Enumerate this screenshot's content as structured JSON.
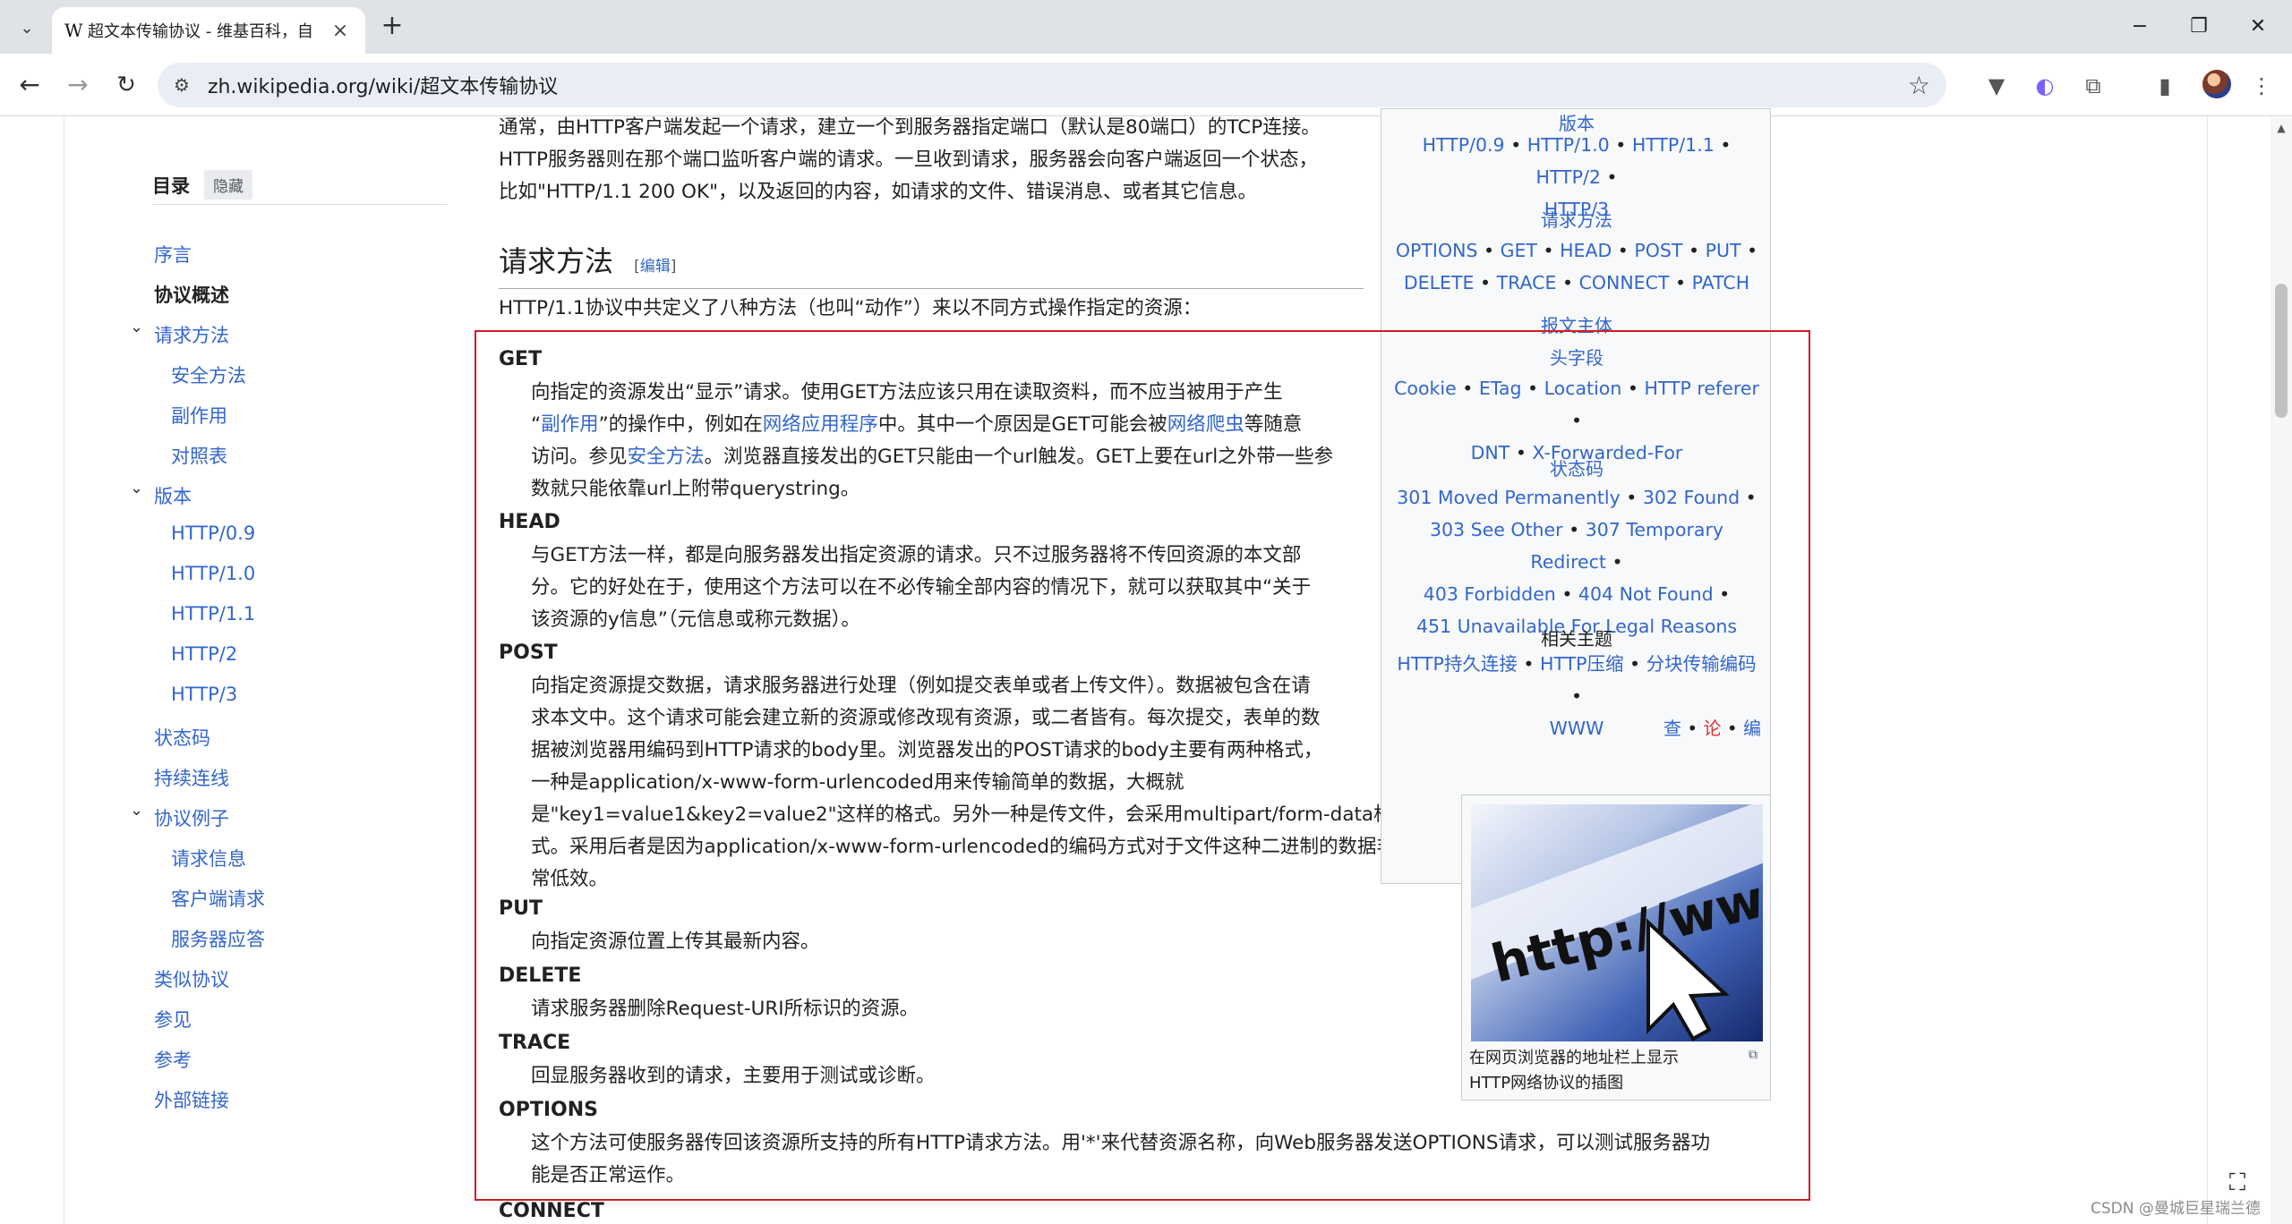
{
  "browser": {
    "tab_title": "超文本传输协议 - 维基百科，自",
    "url": "zh.wikipedia.org/wiki/超文本传输协议",
    "favicon": "W"
  },
  "toc": {
    "title": "目录",
    "hide": "隐藏",
    "items": [
      {
        "label": "序言"
      },
      {
        "label": "协议概述"
      },
      {
        "label": "请求方法"
      },
      {
        "label": "安全方法"
      },
      {
        "label": "副作用"
      },
      {
        "label": "对照表"
      },
      {
        "label": "版本"
      },
      {
        "label": "HTTP/0.9"
      },
      {
        "label": "HTTP/1.0"
      },
      {
        "label": "HTTP/1.1"
      },
      {
        "label": "HTTP/2"
      },
      {
        "label": "HTTP/3"
      },
      {
        "label": "状态码"
      },
      {
        "label": "持续连线"
      },
      {
        "label": "协议例子"
      },
      {
        "label": "请求信息"
      },
      {
        "label": "客户端请求"
      },
      {
        "label": "服务器应答"
      },
      {
        "label": "类似协议"
      },
      {
        "label": "参见"
      },
      {
        "label": "参考"
      },
      {
        "label": "外部链接"
      }
    ]
  },
  "content": {
    "intro_lines": [
      "通常，由HTTP客户端发起一个请求，建立一个到服务器指定端口（默认是80端口）的TCP连接。",
      "HTTP服务器则在那个端口监听客户端的请求。一旦收到请求，服务器会向客户端返回一个状态，",
      "比如\"HTTP/1.1 200 OK\"，以及返回的内容，如请求的文件、错误消息、或者其它信息。"
    ],
    "section_title": "请求方法",
    "edit_open": "[",
    "edit_label": "编辑",
    "edit_close": "]",
    "section_lead": "HTTP/1.1协议中共定义了八种方法（也叫“动作”）来以不同方式操作指定的资源：",
    "methods": [
      {
        "name": "GET",
        "lines": [
          "向指定的资源发出“显示”请求。使用GET方法应该只用在读取资料，而不应当被用于产生",
          [
            "“",
            {
              "link": "副作用"
            },
            "”的操作中，例如在",
            {
              "link": "网络应用程序"
            },
            "中。其中一个原因是GET可能会被",
            {
              "link": "网络爬虫"
            },
            "等随意"
          ],
          [
            "访问。参见",
            {
              "link": "安全方法"
            },
            "。浏览器直接发出的GET只能由一个url触发。GET上要在url之外带一些参"
          ],
          "数就只能依靠url上附带querystring。"
        ]
      },
      {
        "name": "HEAD",
        "lines": [
          "与GET方法一样，都是向服务器发出指定资源的请求。只不过服务器将不传回资源的本文部",
          "分。它的好处在于，使用这个方法可以在不必传输全部内容的情况下，就可以获取其中“关于",
          "该资源的y信息”（元信息或称元数据）。"
        ]
      },
      {
        "name": "POST",
        "lines": [
          "向指定资源提交数据，请求服务器进行处理（例如提交表单或者上传文件）。数据被包含在请",
          "求本文中。这个请求可能会建立新的资源或修改现有资源，或二者皆有。每次提交，表单的数",
          "据被浏览器用编码到HTTP请求的body里。浏览器发出的POST请求的body主要有两种格式，",
          "一种是application/x-www-form-urlencoded用来传输简单的数据，大概就",
          "是\"key1=value1&key2=value2\"这样的格式。另外一种是传文件，会采用multipart/form-data格",
          "式。采用后者是因为application/x-www-form-urlencoded的编码方式对于文件这种二进制的数据非",
          "常低效。"
        ]
      },
      {
        "name": "PUT",
        "lines": [
          "向指定资源位置上传其最新内容。"
        ]
      },
      {
        "name": "DELETE",
        "lines": [
          "请求服务器删除Request-URI所标识的资源。"
        ]
      },
      {
        "name": "TRACE",
        "lines": [
          "回显服务器收到的请求，主要用于测试或诊断。"
        ]
      },
      {
        "name": "OPTIONS",
        "lines": [
          "这个方法可使服务器传回该资源所支持的所有HTTP请求方法。用'*'来代替资源名称，向Web服务器发送OPTIONS请求，可以测试服务器功",
          "能是否正常运作。"
        ]
      },
      {
        "name": "CONNECT",
        "lines": []
      }
    ]
  },
  "navbox": {
    "group_versions": "版本",
    "versions": [
      "HTTP/0.9",
      "HTTP/1.0",
      "HTTP/1.1",
      "HTTP/2",
      "HTTP/3"
    ],
    "group_methods": "请求方法",
    "methods": [
      "OPTIONS",
      "GET",
      "HEAD",
      "POST",
      "PUT",
      "DELETE",
      "TRACE",
      "CONNECT",
      "PATCH"
    ],
    "group_body": "报文主体",
    "group_headers": "头字段",
    "headers": [
      "Cookie",
      "ETag",
      "Location",
      "HTTP referer",
      "DNT",
      "X-Forwarded-For"
    ],
    "group_status": "状态码",
    "status": [
      "301 Moved Permanently",
      "302 Found",
      "303 See Other",
      "307 Temporary Redirect",
      "403 Forbidden",
      "404 Not Found",
      "451 Unavailable For Legal Reasons"
    ],
    "group_related": "相关主题",
    "related": [
      "HTTP持久连接",
      "HTTP压缩",
      "分块传输编码",
      "WWW"
    ],
    "tool_view": "查",
    "tool_talk": "论",
    "tool_edit": "编"
  },
  "image": {
    "thumb_text": "http://www",
    "caption_line1": "在网页浏览器的地址栏上显示",
    "caption_line2": "HTTP网络协议的插图"
  },
  "watermark": "CSDN @曼城巨星瑞兰德",
  "colors": {
    "link": "#3366cc",
    "highlight": "#d11b24",
    "text": "#202122"
  }
}
